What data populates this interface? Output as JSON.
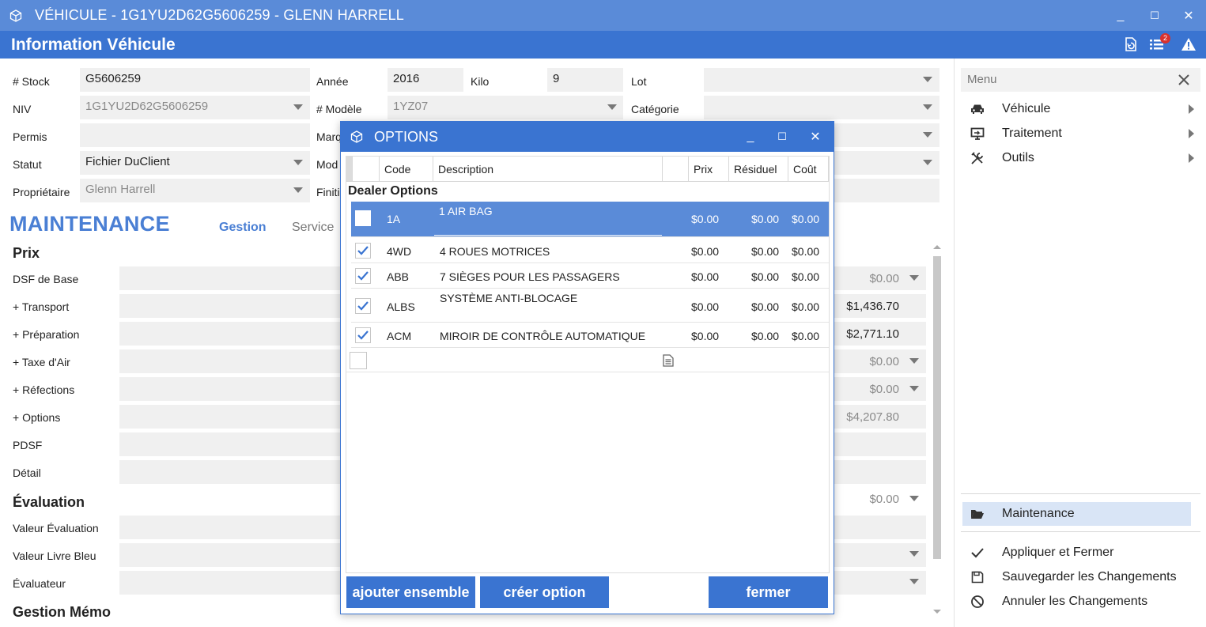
{
  "window": {
    "title": "VÉHICULE - 1G1YU2D62G5606259 - GLENN HARRELL",
    "minimize": "_",
    "maximize": "☐",
    "close": "✕"
  },
  "header": {
    "title": "Information Véhicule",
    "notifications_count": "2"
  },
  "form": {
    "stock_label": "# Stock",
    "stock_value": "G5606259",
    "annee_label": "Année",
    "annee_value": "2016",
    "kilo_label": "Kilo",
    "kilo_value": "9",
    "lot_label": "Lot",
    "lot_value": "",
    "niv_label": "NIV",
    "niv_value": "1G1YU2D62G5606259",
    "modele_num_label": "# Modèle",
    "modele_num_value": "1YZ07",
    "categorie_label": "Catégorie",
    "categorie_value": "",
    "permis_label": "Permis",
    "permis_value": "",
    "marque_label": "Marq",
    "statut_label": "Statut",
    "statut_value": "Fichier DuClient",
    "modele_label": "Mod",
    "proprietaire_label": "Propriétaire",
    "proprietaire_value": "Glenn Harrell",
    "finition_label": "Finiti"
  },
  "maintenance": {
    "title": "MAINTENANCE",
    "tabs": [
      "Gestion",
      "Service"
    ],
    "prix_section": "Prix",
    "prix_rows": [
      {
        "label": "DSF de Base",
        "value": "$0.00"
      },
      {
        "label": "+ Transport",
        "value": "$1,436.70"
      },
      {
        "label": "+ Préparation",
        "value": "$2,771.10"
      },
      {
        "label": "+ Taxe d'Air",
        "value": "$0.00"
      },
      {
        "label": "+ Réfections",
        "value": "$0.00"
      },
      {
        "label": "+ Options",
        "value": "$4,207.80"
      },
      {
        "label": "PDSF",
        "value": ""
      },
      {
        "label": "Détail",
        "value": ""
      }
    ],
    "evaluation_section": "Évaluation",
    "evaluation_value": "$0.00",
    "evaluation_rows": [
      {
        "label": "Valeur Évaluation"
      },
      {
        "label": "Valeur Livre Bleu"
      },
      {
        "label": "Évaluateur"
      }
    ],
    "memo_section": "Gestion Mémo"
  },
  "menu": {
    "header": "Menu",
    "items": [
      {
        "label": "Véhicule",
        "icon": "car-icon"
      },
      {
        "label": "Traitement",
        "icon": "screen-icon"
      },
      {
        "label": "Outils",
        "icon": "tools-icon"
      }
    ],
    "active_item": "Maintenance",
    "actions": [
      {
        "label": "Appliquer et Fermer",
        "icon": "check-icon"
      },
      {
        "label": "Sauvegarder les Changements",
        "icon": "save-icon"
      },
      {
        "label": "Annuler les Changements",
        "icon": "cancel-icon"
      }
    ]
  },
  "dialog": {
    "title": "OPTIONS",
    "columns": [
      "Code",
      "Description",
      "Prix",
      "Résiduel",
      "Coût"
    ],
    "group": "Dealer Options",
    "rows": [
      {
        "checked": false,
        "code": "1A",
        "description": "1 AIR BAG",
        "prix": "$0.00",
        "residuel": "$0.00",
        "cout": "$0.00"
      },
      {
        "checked": true,
        "code": "4WD",
        "description": "4 ROUES MOTRICES",
        "prix": "$0.00",
        "residuel": "$0.00",
        "cout": "$0.00"
      },
      {
        "checked": true,
        "code": "ABB",
        "description": "7 SIÈGES POUR LES PASSAGERS",
        "prix": "$0.00",
        "residuel": "$0.00",
        "cout": "$0.00"
      },
      {
        "checked": true,
        "code": "ALBS",
        "description": "SYSTÈME ANTI-BLOCAGE",
        "prix": "$0.00",
        "residuel": "$0.00",
        "cout": "$0.00"
      },
      {
        "checked": true,
        "code": "ACM",
        "description": "MIROIR DE CONTRÔLE AUTOMATIQUE",
        "prix": "$0.00",
        "residuel": "$0.00",
        "cout": "$0.00"
      }
    ],
    "buttons": {
      "add_set": "ajouter ensemble",
      "create_option": "créer option",
      "close": "fermer"
    }
  },
  "colors": {
    "title_bar": "#5a8bd8",
    "header_bar": "#3a74d1",
    "accent": "#4a7fd4",
    "selection": "#5a8bd8"
  }
}
